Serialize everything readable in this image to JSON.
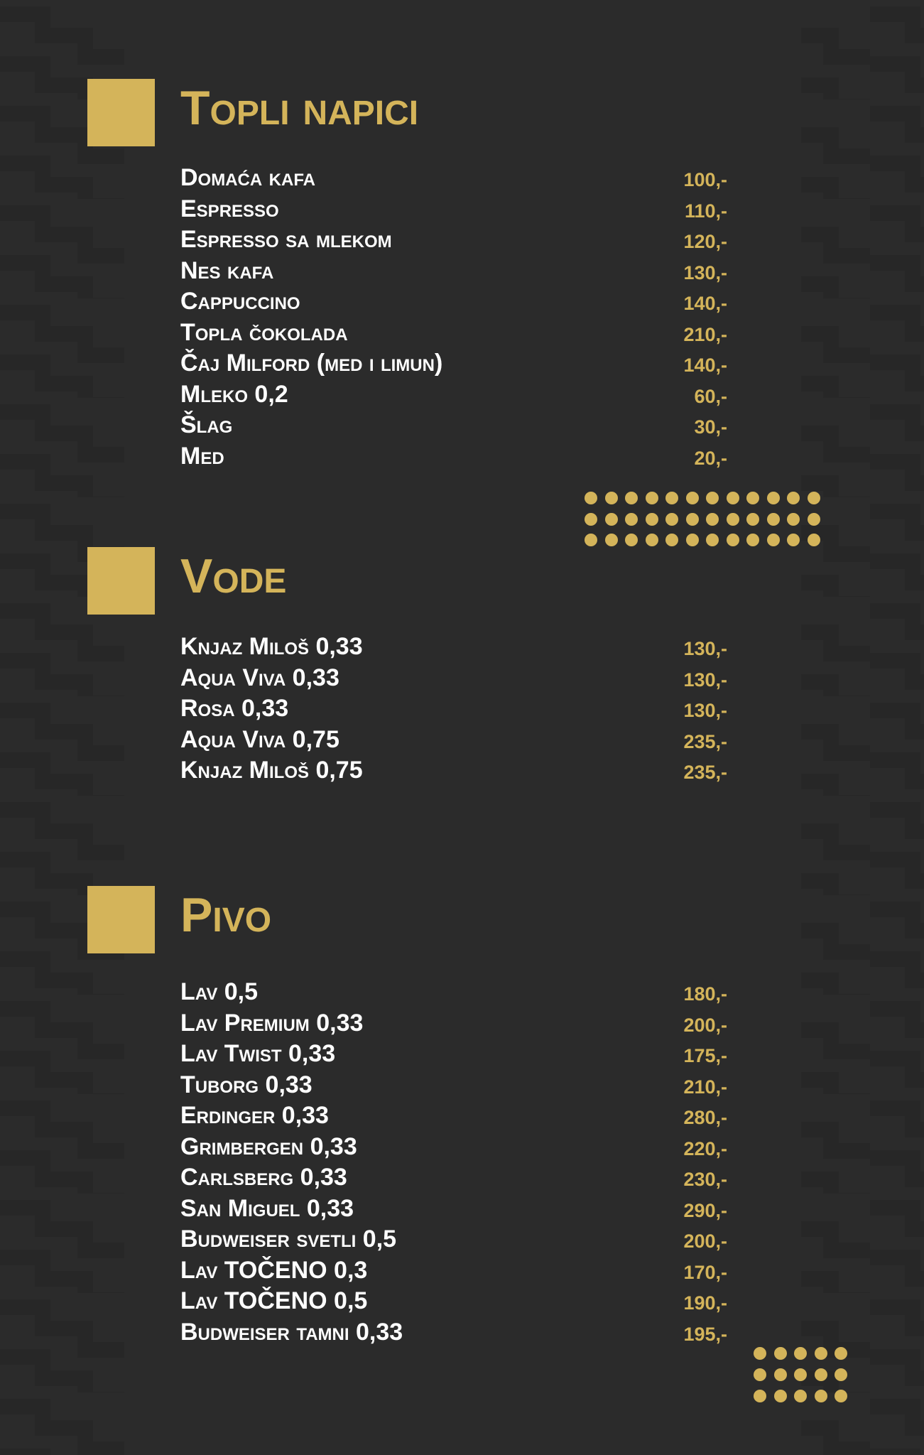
{
  "colors": {
    "background": "#2b2b2b",
    "accent": "#d4b45a",
    "text": "#ffffff"
  },
  "sections": [
    {
      "title": "Topli napici",
      "items": [
        {
          "name": "Domaća kafa",
          "price": "100,-"
        },
        {
          "name": "Espresso",
          "price": "110,-"
        },
        {
          "name": "Espresso sa mlekom",
          "price": "120,-"
        },
        {
          "name": "Nes kafa",
          "price": "130,-"
        },
        {
          "name": "Cappuccino",
          "price": "140,-"
        },
        {
          "name": "Topla čokolada",
          "price": "210,-"
        },
        {
          "name": "Čaj Milford (med i  limun)",
          "price": "140,-"
        },
        {
          "name": "Mleko 0,2",
          "price": "60,-"
        },
        {
          "name": "Šlag",
          "price": "30,-"
        },
        {
          "name": "Med",
          "price": "20,-"
        }
      ]
    },
    {
      "title": "Vode",
      "items": [
        {
          "name": "Knjaz Miloš 0,33",
          "price": "130,-"
        },
        {
          "name": "Aqua Viva 0,33",
          "price": "130,-"
        },
        {
          "name": "Rosa 0,33",
          "price": "130,-"
        },
        {
          "name": "Aqua Viva 0,75",
          "price": "235,-"
        },
        {
          "name": "Knjaz Miloš 0,75",
          "price": "235,-"
        }
      ]
    },
    {
      "title": "Pivo",
      "items": [
        {
          "name": "Lav 0,5",
          "price": "180,-"
        },
        {
          "name": "Lav Premium 0,33",
          "price": "200,-"
        },
        {
          "name": "Lav Twist 0,33",
          "price": "175,-"
        },
        {
          "name": "Tuborg 0,33",
          "price": "210,-"
        },
        {
          "name": "Erdinger 0,33",
          "price": "280,-"
        },
        {
          "name": "Grimbergen 0,33",
          "price": "220,-"
        },
        {
          "name": "Carlsberg 0,33",
          "price": "230,-"
        },
        {
          "name": "San Miguel 0,33",
          "price": "290,-"
        },
        {
          "name": "Budweiser svetli 0,5",
          "price": "200,-"
        },
        {
          "name": "Lav TOČENO 0,3",
          "price": "170,-"
        },
        {
          "name": "Lav TOČENO 0,5",
          "price": "190,-"
        },
        {
          "name": "Budweiser tamni 0,33",
          "price": "195,-"
        }
      ]
    }
  ]
}
